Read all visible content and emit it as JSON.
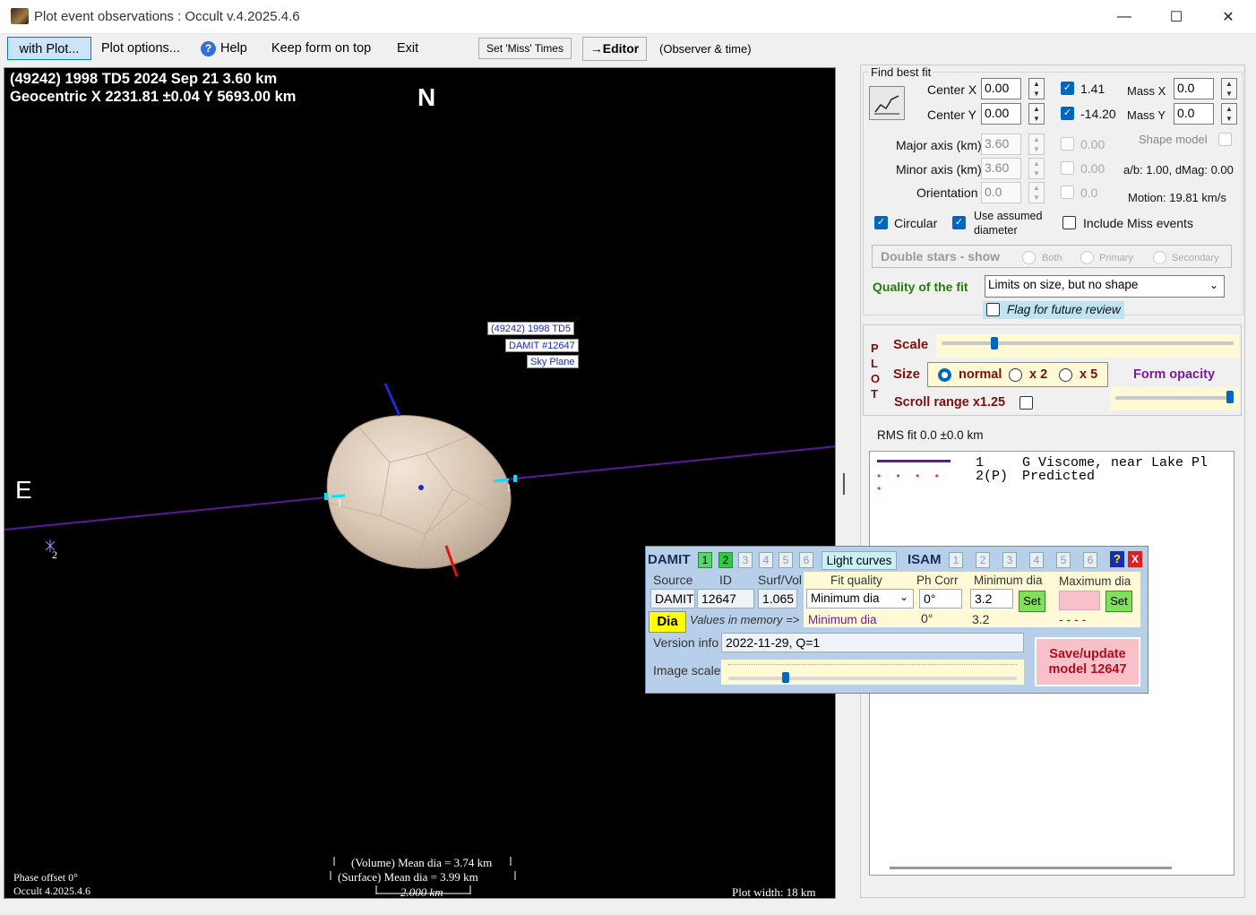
{
  "window": {
    "title": "Plot event observations : Occult v.4.2025.4.6",
    "controls": {
      "minimize": "—",
      "maximize": "☐",
      "close": "✕"
    }
  },
  "menu": {
    "with_plot": "with Plot...",
    "plot_options": "Plot options...",
    "help": "Help",
    "keep_on_top": "Keep form on top",
    "exit": "Exit",
    "set_miss_times": "Set 'Miss' Times",
    "editor": "→Editor",
    "observer_time": "(Observer & time)"
  },
  "plot": {
    "header_line1": "(49242) 1998 TD5  2024 Sep 21   3.60 km",
    "header_line2": "Geocentric  X  2231.81 ±0.04  Y 5693.00 km",
    "north": "N",
    "east": "E",
    "label_object": "(49242) 1998 TD5",
    "label_damit": "DAMIT #12647",
    "label_plane": "Sky Plane",
    "chord_1_label": "1",
    "chord_1b_label": "1",
    "chord_2_label": "2",
    "volume_dia": "(Volume) Mean dia = 3.74 km",
    "surface_dia": "(Surface) Mean dia = 3.99 km",
    "scale_bar": "2.000 km",
    "phase_offset": "Phase offset 0°",
    "version": "Occult 4.2025.4.6",
    "plot_width": "Plot width: 18 km"
  },
  "fit": {
    "title": "Find best fit",
    "center_x_label": "Center X",
    "center_x": "0.00",
    "center_y_label": "Center Y",
    "center_y": "0.00",
    "cx_checked_value": "1.41",
    "cy_checked_value": "-14.20",
    "mass_x_label": "Mass X",
    "mass_x": "0.0",
    "mass_y_label": "Mass Y",
    "mass_y": "0.0",
    "major_label": "Major axis (km)",
    "major": "3.60",
    "major_cb": "0.00",
    "minor_label": "Minor axis (km)",
    "minor": "3.60",
    "minor_cb": "0.00",
    "orient_label": "Orientation",
    "orient": "0.0",
    "orient_cb": "0.0",
    "shape_model": "Shape model",
    "ab_dmag": "a/b: 1.00, dMag: 0.00",
    "motion": "Motion: 19.81 km/s",
    "circular": "Circular",
    "use_assumed_1": "Use assumed",
    "use_assumed_2": "diameter",
    "include_miss": "Include Miss events",
    "double_stars": "Double stars - show",
    "both": "Both",
    "primary": "Primary",
    "secondary": "Secondary",
    "quality_label": "Quality of the fit",
    "quality_value": "Limits on size, but no shape",
    "flag_review": "Flag for future review"
  },
  "plotctl": {
    "side_letters": [
      "P",
      "L",
      "O",
      "T"
    ],
    "scale": "Scale",
    "size": "Size",
    "normal": "normal",
    "x2": "x 2",
    "x5": "x 5",
    "form_opacity": "Form opacity",
    "scroll_range": "Scroll range x1.25",
    "scale_level": 0.18,
    "opacity_level": 0.97
  },
  "rms": "RMS fit 0.0 ±0.0 km",
  "legend": {
    "row1_num": "1",
    "row1_text": "G Viscome, near Lake Pl",
    "row2_num": "2(P)",
    "row2_text": "Predicted"
  },
  "damit": {
    "damit": "DAMIT",
    "damit_nums": [
      "1",
      "2",
      "3",
      "4",
      "5",
      "6"
    ],
    "light_curves": "Light curves",
    "isam": "ISAM",
    "isam_nums": [
      "1",
      "2",
      "3",
      "4",
      "5",
      "6"
    ],
    "help": "?",
    "close": "X",
    "source_h": "Source",
    "id_h": "ID",
    "surfvol_h": "Surf/Vol",
    "source": "DAMIT",
    "id": "12647",
    "surfvol": "1.065",
    "fit_quality_h": "Fit quality",
    "ph_corr_h": "Ph Corr",
    "min_dia_h": "Minimum dia",
    "max_dia_h": "Maximum dia",
    "fit_quality": "Minimum dia",
    "ph_corr": "0°",
    "min_dia": "3.2",
    "set": "Set",
    "dia": "Dia",
    "values_memory": "Values in memory =>",
    "mem_fit": "Minimum dia",
    "mem_ph": "0°",
    "mem_min": "3.2",
    "mem_max": "- - - -",
    "version_label": "Version info",
    "version_value": "2022-11-29, Q=1",
    "image_scale": "Image scale",
    "save_1": "Save/update",
    "save_2": "model  12647"
  }
}
